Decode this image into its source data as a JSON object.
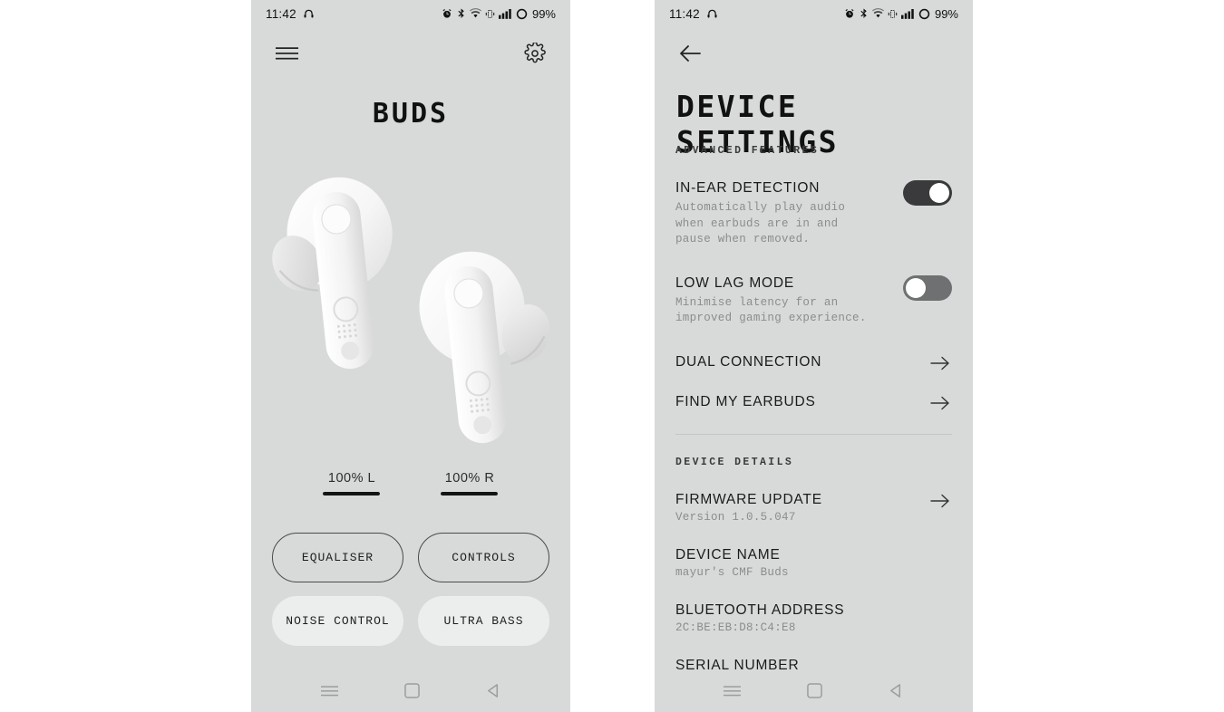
{
  "status_bar": {
    "time": "11:42",
    "battery_percent": "99%",
    "icons": [
      "headphones-icon",
      "alarm-icon",
      "bluetooth-icon",
      "wifi-icon",
      "vibrate-icon",
      "signal-icon",
      "battery-ring-icon"
    ]
  },
  "colors": {
    "panel_bg": "#d8dada",
    "page_bg": "#ffffff",
    "text_primary": "#1a1a1a",
    "text_muted": "#8b8d8d",
    "toggle_on": "#3a3a3c",
    "toggle_off": "#6e7072",
    "battery_fill": "#141414",
    "pill_filled": "#eceded"
  },
  "left_screen": {
    "menu_icon": "hamburger-menu-icon",
    "settings_icon": "gear-icon",
    "title": "BUDS",
    "product_image": "white-wireless-earbuds",
    "battery": [
      {
        "label": "100% L",
        "percent": 100,
        "side": "L"
      },
      {
        "label": "100% R",
        "percent": 100,
        "side": "R"
      }
    ],
    "buttons": [
      {
        "label": "EQUALISER",
        "style": "outline"
      },
      {
        "label": "CONTROLS",
        "style": "outline"
      },
      {
        "label": "NOISE CONTROL",
        "style": "filled"
      },
      {
        "label": "ULTRA BASS",
        "style": "filled"
      }
    ]
  },
  "right_screen": {
    "back_icon": "back-arrow-icon",
    "title": "DEVICE SETTINGS",
    "sections": [
      {
        "label": "ADVANCED FEATURES",
        "toggles": [
          {
            "title": "IN-EAR DETECTION",
            "description": "Automatically play audio when earbuds are in and pause when removed.",
            "state": "on"
          },
          {
            "title": "LOW LAG MODE",
            "description": "Minimise latency for an improved gaming experience.",
            "state": "off"
          }
        ],
        "links": [
          {
            "title": "DUAL CONNECTION",
            "icon": "chevron-right-arrow-icon"
          },
          {
            "title": "FIND MY EARBUDS",
            "icon": "chevron-right-arrow-icon"
          }
        ]
      },
      {
        "label": "DEVICE DETAILS",
        "items": [
          {
            "title": "FIRMWARE UPDATE",
            "value": "Version 1.0.5.047",
            "has_arrow": true
          },
          {
            "title": "DEVICE NAME",
            "value": "mayur's CMF Buds",
            "has_arrow": false
          },
          {
            "title": "BLUETOOTH ADDRESS",
            "value": "2C:BE:EB:D8:C4:E8",
            "has_arrow": false
          },
          {
            "title": "SERIAL NUMBER",
            "value": "",
            "has_arrow": false
          }
        ]
      }
    ]
  },
  "nav_bar": {
    "recents": "recents-icon",
    "home": "home-icon",
    "back": "back-triangle-icon"
  }
}
